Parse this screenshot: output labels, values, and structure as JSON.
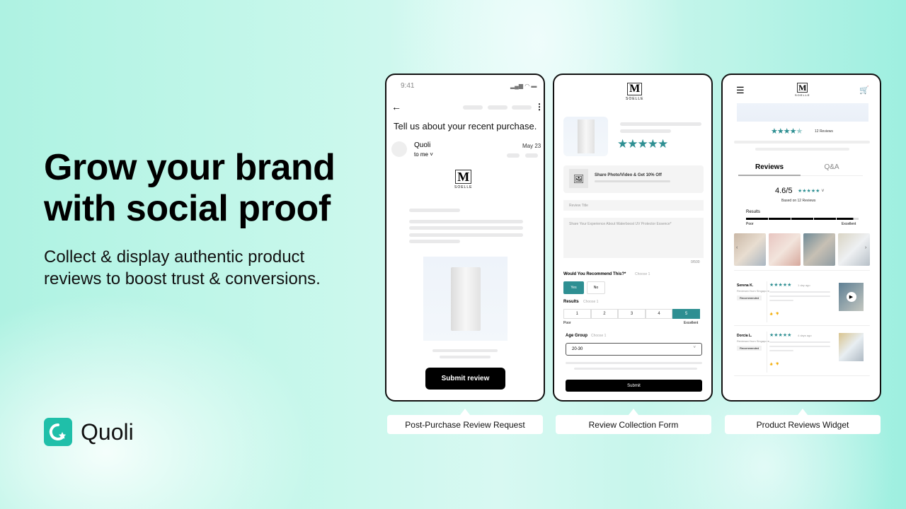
{
  "hero": {
    "headline_line1": "Grow your brand",
    "headline_line2": "with social proof",
    "subtitle_line1": "Collect & display authentic product",
    "subtitle_line2": "reviews to boost trust & conversions."
  },
  "brand": {
    "name": "Quoli",
    "logo_icon": "q-star-icon",
    "accent": "#1fbfa9"
  },
  "email_screen": {
    "status_time": "9:41",
    "subject": "Tell us about your recent purchase.",
    "sender": "Quoli",
    "recipient": "to me",
    "date": "May 23",
    "store_logo": "SOELLE",
    "submit_label": "Submit review",
    "caption": "Post-Purchase Review Request"
  },
  "form_screen": {
    "store_logo": "SOELLE",
    "rating_stars": 5,
    "share_media": "Share Photo/Video & Get 10% Off",
    "review_title_placeholder": "Review Title",
    "review_body_placeholder": "Share Your Experience About Waterboost UV Protector Essence*",
    "char_count": "0/500",
    "recommend_label": "Would You Recommend This?*",
    "recommend_hint": "Choose 1",
    "yes_label": "Yes",
    "no_label": "No",
    "results_label": "Results",
    "results_hint": "Choose 1",
    "scale": [
      "1",
      "2",
      "3",
      "4",
      "5"
    ],
    "selected_scale": "5",
    "scale_low": "Poor",
    "scale_high": "Excellent",
    "age_label": "Age Group",
    "age_hint": "Choose 1",
    "age_value": "20-30",
    "submit_label": "Submit",
    "accent": "#2e8f92",
    "caption": "Review Collection Form"
  },
  "widget_screen": {
    "store_logo": "SOELLE",
    "review_count_label": "12 Reviews",
    "tabs": [
      "Reviews",
      "Q&A"
    ],
    "active_tab": "Reviews",
    "average": "4.6/5",
    "based_on": "Based on 12 Reviews",
    "results_label": "Results",
    "results_low": "Poor",
    "results_high": "Excellent",
    "results_fraction": 0.95,
    "reviews": [
      {
        "name": "Serena K.",
        "location": "Reviewed from Singapore",
        "badge": "Recommended",
        "time": "1 day ago",
        "stars": 5,
        "has_video": true
      },
      {
        "name": "Dorcia L.",
        "location": "Reviewed from Singapore",
        "badge": "Recommended",
        "time": "4 days ago",
        "stars": 5,
        "has_video": false
      }
    ],
    "caption": "Product Reviews Widget"
  }
}
